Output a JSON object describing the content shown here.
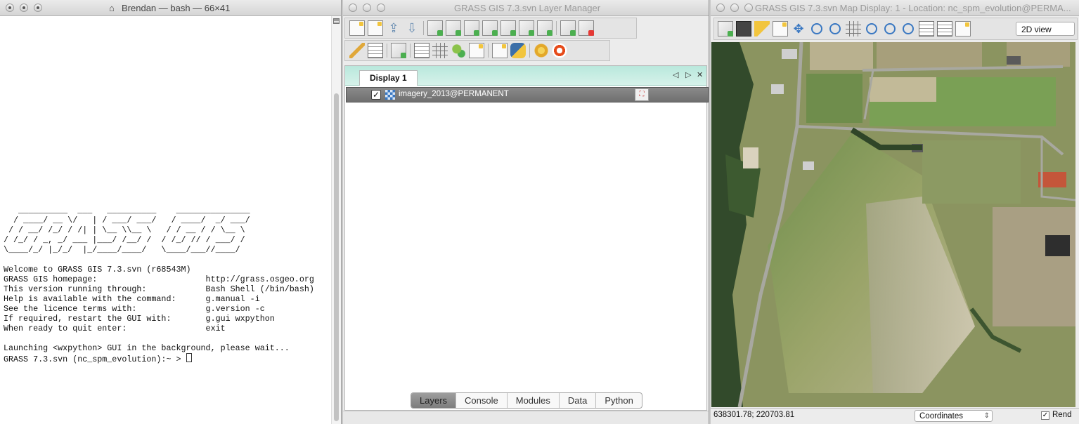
{
  "terminal": {
    "title": "Brendan — bash — 66×41",
    "banner": "   __________  ___   __________    _______________\n  / ____/ __ \\/   | / ___/ ___/   / ____/  _/ ___/\n / / __/ /_/ / /| | \\__ \\\\__ \\   / / __ / / \\__ \\\n/ /_/ / _, _/ ___ |___/ /__/ /  / /_/ // / ___/ /\n\\____/_/ |_/_/  |_/____/____/   \\____/___//____/",
    "lines": [
      "Welcome to GRASS GIS 7.3.svn (r68543M)",
      "GRASS GIS homepage:                      http://grass.osgeo.org",
      "This version running through:            Bash Shell (/bin/bash)",
      "Help is available with the command:      g.manual -i",
      "See the licence terms with:              g.version -c",
      "If required, restart the GUI with:       g.gui wxpython",
      "When ready to quit enter:                exit",
      "",
      "Launching <wxpython> GUI in the background, please wait..."
    ],
    "prompt": "GRASS 7.3.svn (nc_spm_evolution):~ > "
  },
  "layer_manager": {
    "title": "GRASS GIS 7.3.svn Layer Manager",
    "notebook_tab": "Display 1",
    "nav_prev": "◁",
    "nav_next": "▷",
    "close": "✕",
    "layer": {
      "name": "imagery_2013@PERMANENT",
      "checked": true,
      "checkmark": "✓"
    },
    "bottom_tabs": [
      "Layers",
      "Console",
      "Modules",
      "Data",
      "Python"
    ]
  },
  "map_display": {
    "title": "GRASS GIS 7.3.svn Map Display: 1 - Location: nc_spm_evolution@PERMA...",
    "view_mode": "2D view",
    "coordinates": "638301.78; 220703.81",
    "status_mode": "Coordinates",
    "render_label": "Rend",
    "render_checked": true,
    "checkmark": "✓"
  },
  "colors": {
    "notebook_header": "#c8eee2",
    "layer_row": "#7a7a7a",
    "map_ground": "#7f8e5a"
  }
}
